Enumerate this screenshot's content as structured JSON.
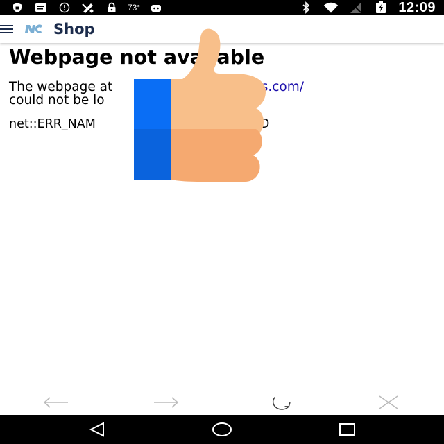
{
  "status_bar": {
    "left_icons": [
      "shield-icon",
      "message-icon",
      "do-not-disturb-icon",
      "fantasy-icon",
      "lock-icon"
    ],
    "temperature": "73°",
    "time": "12:09",
    "right_icons": [
      "bluetooth-icon",
      "wifi-icon",
      "no-signal-icon",
      "battery-charging-icon"
    ]
  },
  "app_bar": {
    "menu_icon": "hamburger-menu-icon",
    "logo_icon": "nc-logo-icon",
    "title": "Shop"
  },
  "error_page": {
    "title": "Webpage not available",
    "body_prefix": "The webpage at",
    "url_visible": ".goheels.com/",
    "body_suffix": "could not be lo",
    "error_code_prefix": "net::ERR_NAM",
    "error_code_suffix": "VED"
  },
  "overlay": {
    "icon": "thumbs-up-icon",
    "colors": {
      "cuff": "#0a6ef5",
      "hand": "#f7b27a"
    }
  },
  "browser_nav": {
    "back": "back-arrow-icon",
    "forward": "forward-arrow-icon",
    "refresh": "refresh-icon",
    "close": "close-icon"
  },
  "system_nav": {
    "back": "nav-back-icon",
    "home": "nav-home-icon",
    "recents": "nav-recents-icon"
  }
}
